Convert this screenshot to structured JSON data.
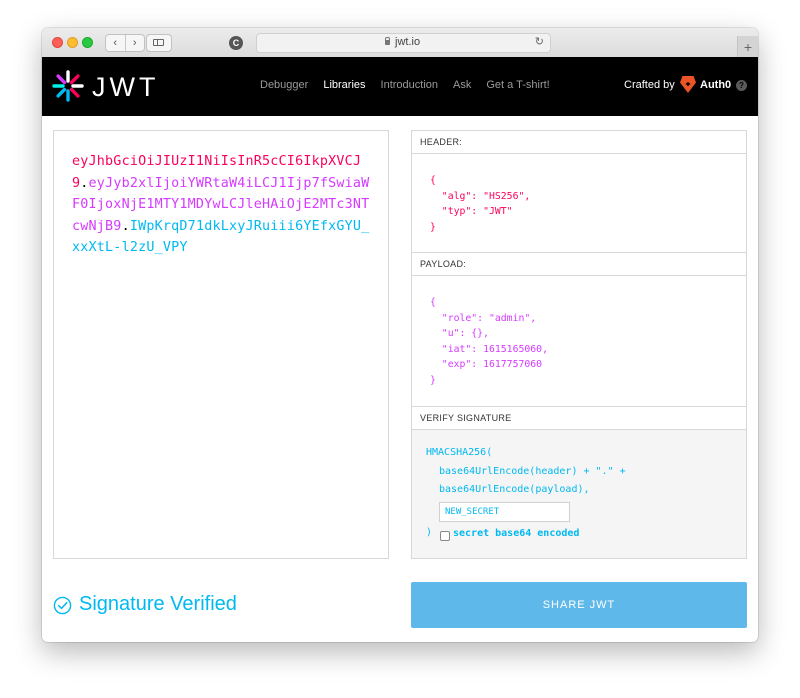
{
  "browser": {
    "url": "jwt.io",
    "new_tab": "+",
    "back_glyph": "‹",
    "forward_glyph": "›",
    "site_icon_letter": "C",
    "reload_glyph": "↻"
  },
  "header": {
    "logo_text": "JWT",
    "nav": [
      "Debugger",
      "Libraries",
      "Introduction",
      "Ask",
      "Get a T-shirt!"
    ],
    "active_nav": "Libraries",
    "crafted_by": "Crafted by",
    "brand": "Auth0",
    "help": "?"
  },
  "encoded": {
    "header_part": "eyJhbGciOiJIUzI1NiIsInR5cCI6IkpXVCJ9",
    "payload_part": "eyJyb2xlIjoiYWRtaW4iLCJ1Ijp7fSwiaWF0IjoxNjE1MTY1MDYwLCJleHAiOjE2MTc3NTcwNjB9",
    "signature_part": "IWpKrqD71dkLxyJRuiii6YEfxGYU_xxXtL-l2zU_VPY",
    "separator": "."
  },
  "decoded": {
    "header_title": "HEADER:",
    "header_json": "{\n  \"alg\": \"HS256\",\n  \"typ\": \"JWT\"\n}",
    "payload_title": "PAYLOAD:",
    "payload_json": "{\n  \"role\": \"admin\",\n  \"u\": {},\n  \"iat\": 1615165060,\n  \"exp\": 1617757060\n}",
    "verify_title": "VERIFY SIGNATURE",
    "verify_fn": "HMACSHA256(",
    "verify_line1": "base64UrlEncode(header) + \".\" +",
    "verify_line2": "base64UrlEncode(payload),",
    "secret_value": "NEW_SECRET",
    "close_paren": ")",
    "checkbox_label": "secret base64 encoded"
  },
  "status": {
    "verified_text": "Signature Verified"
  },
  "share_button": "SHARE JWT",
  "colors": {
    "header_red": "#fb015b",
    "payload_purple": "#d63aff",
    "signature_blue": "#00b9f1",
    "share_button": "#5fb8ea"
  },
  "icons": [
    "lock-icon",
    "reload-icon",
    "jwt-logo-icon",
    "auth0-logo-icon",
    "help-icon",
    "check-circle-icon"
  ]
}
